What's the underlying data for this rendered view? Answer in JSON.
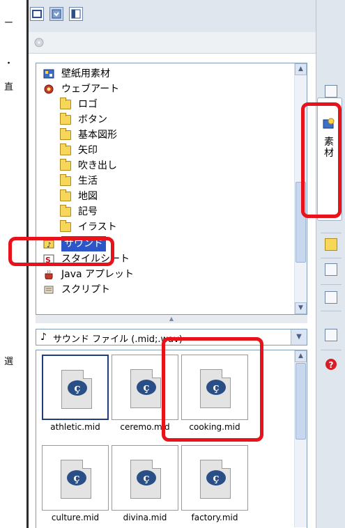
{
  "left_fragments": [
    {
      "text": "ー"
    },
    {
      "text": "・"
    },
    {
      "text": "直"
    },
    {
      "text": "選"
    }
  ],
  "tree": {
    "items": [
      {
        "label": "壁紙用素材",
        "icon": "wallpaper-icon",
        "indent": 0
      },
      {
        "label": "ウェブアート",
        "icon": "webart-icon",
        "indent": 0
      },
      {
        "label": "ロゴ",
        "icon": "folder-icon",
        "indent": 1
      },
      {
        "label": "ボタン",
        "icon": "folder-icon",
        "indent": 1
      },
      {
        "label": "基本図形",
        "icon": "folder-icon",
        "indent": 1
      },
      {
        "label": "矢印",
        "icon": "folder-icon",
        "indent": 1
      },
      {
        "label": "吹き出し",
        "icon": "folder-icon",
        "indent": 1
      },
      {
        "label": "生活",
        "icon": "folder-icon",
        "indent": 1
      },
      {
        "label": "地図",
        "icon": "folder-icon",
        "indent": 1
      },
      {
        "label": "記号",
        "icon": "folder-icon",
        "indent": 1
      },
      {
        "label": "イラスト",
        "icon": "folder-icon",
        "indent": 1
      },
      {
        "label": "サウンド",
        "icon": "sound-icon",
        "indent": 0,
        "selected": true
      },
      {
        "label": "スタイルシート",
        "icon": "stylesheet-icon",
        "indent": 0
      },
      {
        "label": "Java アプレット",
        "icon": "java-icon",
        "indent": 0
      },
      {
        "label": "スクリプト",
        "icon": "script-icon",
        "indent": 0
      }
    ]
  },
  "filter": {
    "icon": "music-note-icon",
    "value": "サウンド ファイル (.mid;.wav)"
  },
  "files": [
    {
      "name": "athletic.mid",
      "selected": true
    },
    {
      "name": "ceremo.mid"
    },
    {
      "name": "cooking.mid"
    },
    {
      "name": "culture.mid"
    },
    {
      "name": "divina.mid"
    },
    {
      "name": "factory.mid"
    }
  ],
  "side_tab": {
    "label": "素材",
    "label_chars": [
      "素",
      "材"
    ]
  },
  "colors": {
    "highlight": "#e8121b",
    "selection": "#2c56c8",
    "panel_bg": "#dfe6ee"
  }
}
